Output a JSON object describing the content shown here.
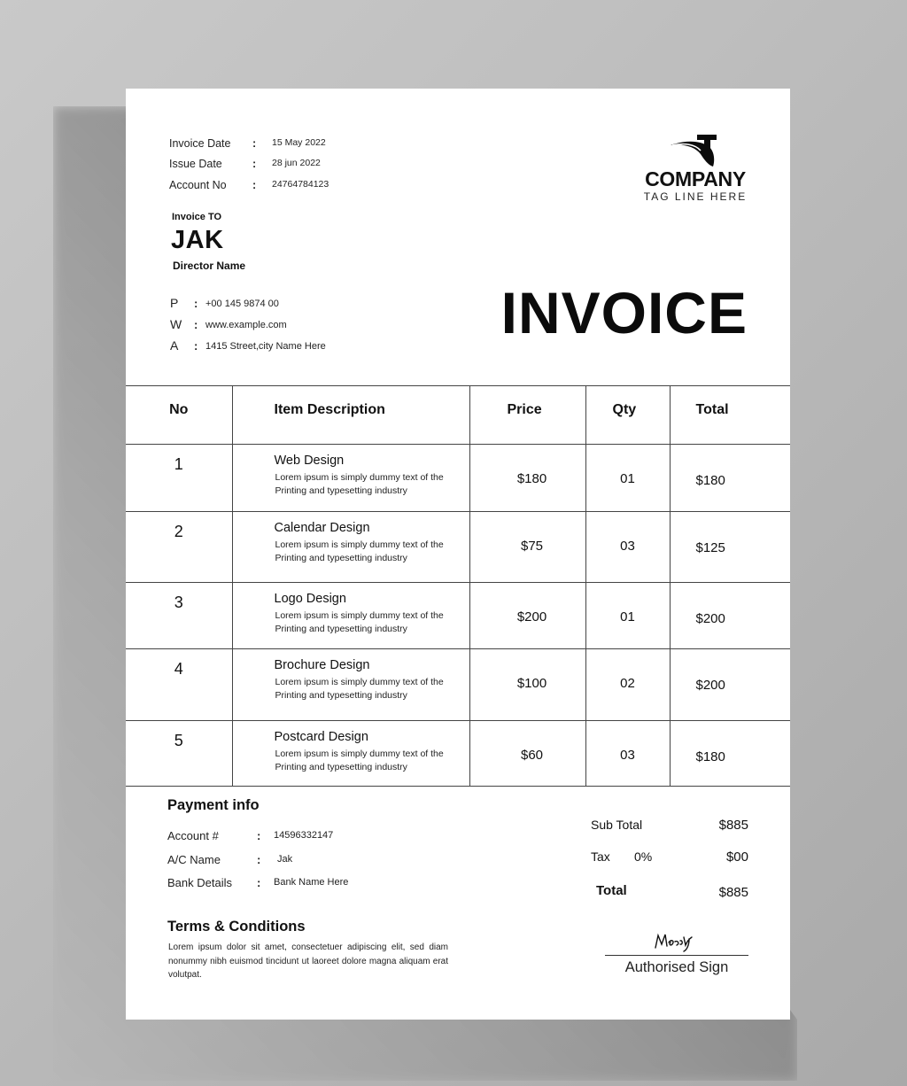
{
  "meta": {
    "rows": [
      {
        "label": "Invoice Date",
        "value": "15 May 2022"
      },
      {
        "label": "Issue Date",
        "value": "28 jun 2022"
      },
      {
        "label": "Account No",
        "value": "24764784123"
      }
    ],
    "separator": ":"
  },
  "logo": {
    "icon": "t-swoosh-logo-icon",
    "company": "COMPANY",
    "tagline": "TAG LINE HERE"
  },
  "invoice_to": {
    "label": "Invoice TO",
    "name": "JAK",
    "role": "Director Name",
    "contacts": [
      {
        "key": "P",
        "value": "+00 145 9874 00"
      },
      {
        "key": "W",
        "value": "www.example.com"
      },
      {
        "key": "A",
        "value": "1415 Street,city Name Here"
      }
    ]
  },
  "title": "INVOICE",
  "table": {
    "headers": {
      "no": "No",
      "desc": "Item Description",
      "price": "Price",
      "qty": "Qty",
      "total": "Total"
    },
    "rows": [
      {
        "no": "1",
        "name": "Web Design",
        "desc": "Lorem ipsum is simply dummy text of the Printing and typesetting industry",
        "price": "$180",
        "qty": "01",
        "total": "$180"
      },
      {
        "no": "2",
        "name": "Calendar Design",
        "desc": "Lorem ipsum is simply dummy text of the Printing and typesetting industry",
        "price": "$75",
        "qty": "03",
        "total": "$125"
      },
      {
        "no": "3",
        "name": "Logo Design",
        "desc": "Lorem ipsum is simply dummy text of the Printing and typesetting industry",
        "price": "$200",
        "qty": "01",
        "total": "$200"
      },
      {
        "no": "4",
        "name": "Brochure Design",
        "desc": "Lorem ipsum is simply dummy text of the Printing and typesetting industry",
        "price": "$100",
        "qty": "02",
        "total": "$200"
      },
      {
        "no": "5",
        "name": "Postcard Design",
        "desc": "Lorem ipsum is simply dummy text of the Printing and typesetting industry",
        "price": "$60",
        "qty": "03",
        "total": "$180"
      }
    ]
  },
  "payment": {
    "title": "Payment info",
    "rows": [
      {
        "label": "Account #",
        "value": "14596332147"
      },
      {
        "label": "A/C Name",
        "value": "Jak"
      },
      {
        "label": "Bank Details",
        "value": "Bank Name Here"
      }
    ]
  },
  "totals": {
    "subtotal_label": "Sub Total",
    "subtotal": "$885",
    "tax_label": "Tax",
    "tax_rate": "0%",
    "tax": "$00",
    "total_label": "Total",
    "total": "$885"
  },
  "terms": {
    "title": "Terms & Conditions",
    "body": "Lorem ipsum dolor sit amet, consectetuer adipiscing elit, sed diam nonummy nibh euismod tincidunt ut laoreet dolore magna aliquam erat volutpat."
  },
  "signature": {
    "label": "Authorised Sign"
  }
}
